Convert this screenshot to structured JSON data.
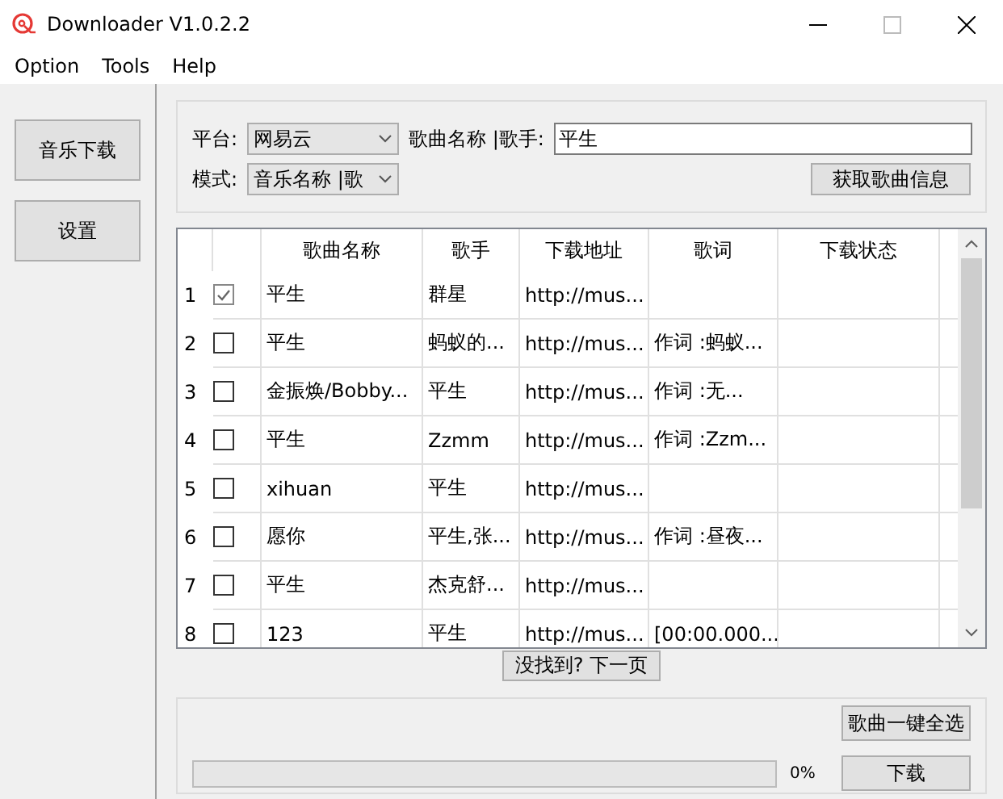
{
  "window": {
    "title": "Downloader V1.0.2.2"
  },
  "menu": [
    "Option",
    "Tools",
    "Help"
  ],
  "sidebar": {
    "buttons": [
      "音乐下载",
      "设置"
    ]
  },
  "search": {
    "platform": {
      "label": "平台:",
      "value": "网易云"
    },
    "mode": {
      "label": "模式:",
      "value": "音乐名称 |歌"
    },
    "query": {
      "label": "歌曲名称 |歌手:",
      "value": "平生"
    },
    "fetch_button": "获取歌曲信息"
  },
  "table": {
    "columns": [
      "歌曲名称",
      "歌手",
      "下载地址",
      "歌词",
      "下载状态"
    ],
    "rows": [
      {
        "index": "1",
        "checked": true,
        "cells": [
          "平生",
          "群星",
          "http://mus...",
          ""
        ]
      },
      {
        "index": "2",
        "checked": false,
        "cells": [
          "平生",
          "蚂蚁的...",
          "http://mus...",
          "作词 :蚂蚁..."
        ]
      },
      {
        "index": "3",
        "checked": false,
        "cells": [
          "金振焕/Bobby...",
          "平生",
          "http://mus...",
          "作词 :无..."
        ]
      },
      {
        "index": "4",
        "checked": false,
        "cells": [
          "平生",
          "Zzmm",
          "http://mus...",
          "作词 :Zzm..."
        ]
      },
      {
        "index": "5",
        "checked": false,
        "cells": [
          "xihuan",
          "平生",
          "http://mus...",
          ""
        ]
      },
      {
        "index": "6",
        "checked": false,
        "cells": [
          "愿你",
          "平生,张...",
          "http://mus...",
          "作词 :昼夜..."
        ]
      },
      {
        "index": "7",
        "checked": false,
        "cells": [
          "平生",
          "杰克舒...",
          "http://mus...",
          ""
        ]
      },
      {
        "index": "8",
        "checked": false,
        "cells": [
          "123",
          "平生",
          "http://mus...",
          "[00:00.000..."
        ]
      }
    ]
  },
  "next_page_button": "没找到? 下一页",
  "select_all_button": "歌曲一键全选",
  "progress": {
    "level": 0,
    "reading": "0%"
  },
  "download_button": "下载"
}
